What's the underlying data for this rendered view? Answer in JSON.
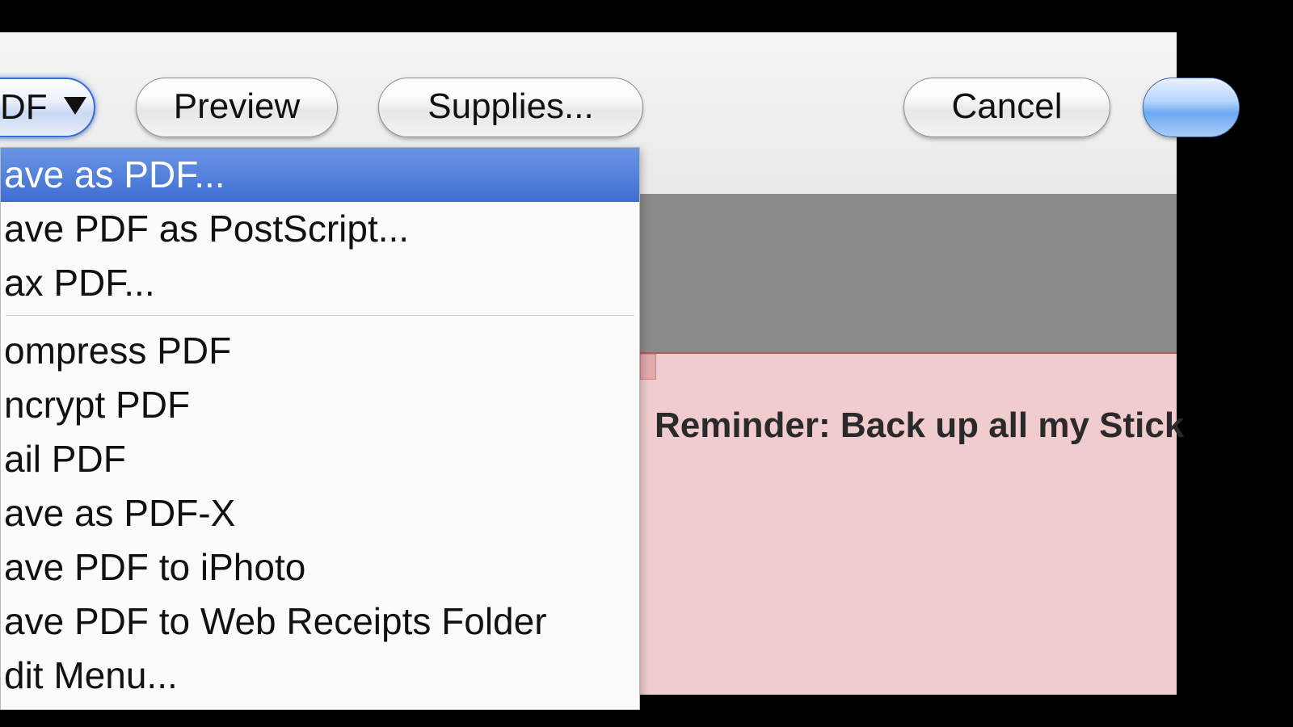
{
  "toolbar": {
    "pdf_button_label": "DF",
    "pdf_button_glyph": "▼",
    "preview_label": "Preview",
    "supplies_label": "Supplies...",
    "cancel_label": "Cancel"
  },
  "pdf_menu": {
    "group1": [
      "ave as PDF...",
      "ave PDF as PostScript...",
      "ax PDF..."
    ],
    "group2": [
      "ompress PDF",
      "ncrypt PDF",
      "ail PDF",
      "ave as PDF-X",
      "ave PDF to iPhoto",
      "ave PDF to Web Receipts Folder",
      "dit Menu..."
    ],
    "selected_index": 0
  },
  "sticky": {
    "text": "Reminder: Back up all my Stick"
  }
}
